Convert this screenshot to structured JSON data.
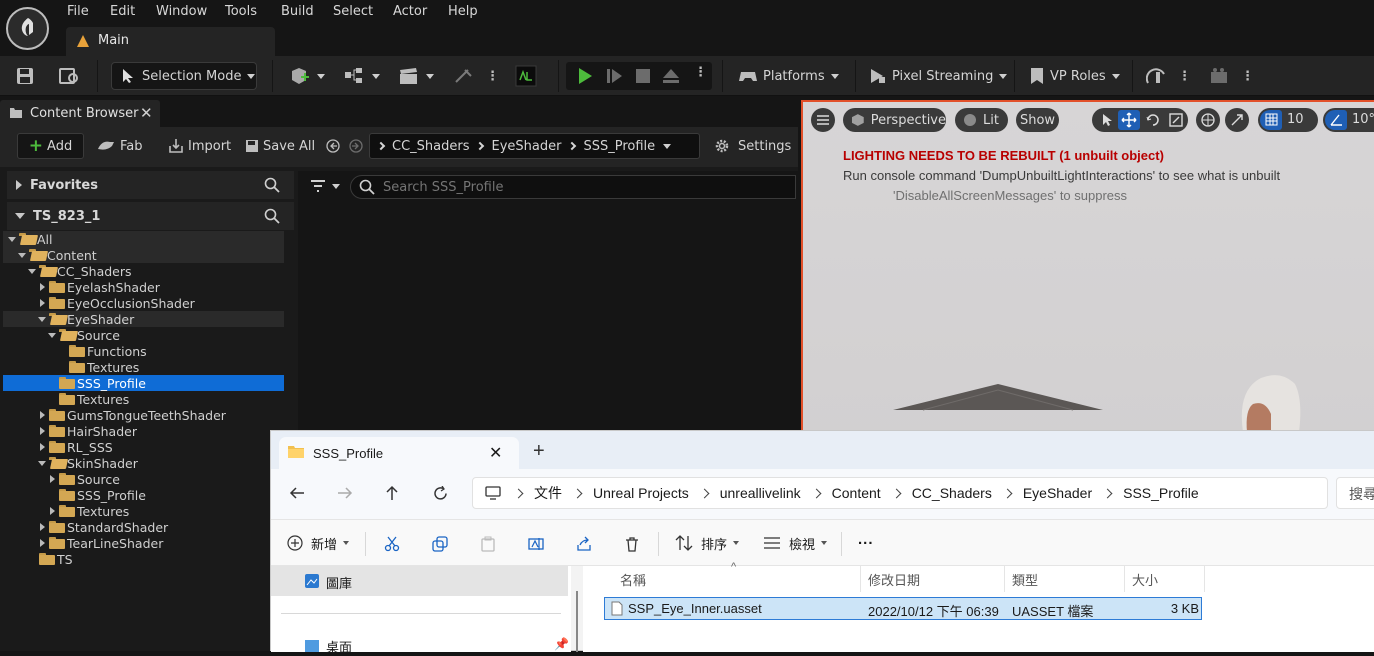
{
  "menu": {
    "items": [
      "File",
      "Edit",
      "Window",
      "Tools",
      "Build",
      "Select",
      "Actor",
      "Help"
    ],
    "tab_label": "Main"
  },
  "toolbar": {
    "selection_mode": "Selection Mode",
    "platforms": "Platforms",
    "pixel_streaming": "Pixel Streaming",
    "vp_roles": "VP Roles"
  },
  "content_browser": {
    "tab_title": "Content Browser",
    "add": "Add",
    "fab": "Fab",
    "import": "Import",
    "save_all": "Save All",
    "settings": "Settings",
    "breadcrumbs": [
      "CC_Shaders",
      "EyeShader",
      "SSS_Profile"
    ],
    "favorites": "Favorites",
    "project": "TS_823_1",
    "search_placeholder": "Search SSS_Profile",
    "tree": [
      {
        "label": "All",
        "indent": 0,
        "expand": "down",
        "open": true
      },
      {
        "label": "Content",
        "indent": 1,
        "expand": "down",
        "open": true
      },
      {
        "label": "CC_Shaders",
        "indent": 2,
        "expand": "down",
        "open": true
      },
      {
        "label": "EyelashShader",
        "indent": 3,
        "expand": "right",
        "open": false
      },
      {
        "label": "EyeOcclusionShader",
        "indent": 3,
        "expand": "right",
        "open": false
      },
      {
        "label": "EyeShader",
        "indent": 3,
        "expand": "down",
        "open": true
      },
      {
        "label": "Source",
        "indent": 4,
        "expand": "down",
        "open": true
      },
      {
        "label": "Functions",
        "indent": 5,
        "expand": "none",
        "open": false
      },
      {
        "label": "Textures",
        "indent": 5,
        "expand": "none",
        "open": false
      },
      {
        "label": "SSS_Profile",
        "indent": 4,
        "expand": "none",
        "open": false
      },
      {
        "label": "Textures",
        "indent": 4,
        "expand": "none",
        "open": false
      },
      {
        "label": "GumsTongueTeethShader",
        "indent": 3,
        "expand": "right",
        "open": false
      },
      {
        "label": "HairShader",
        "indent": 3,
        "expand": "right",
        "open": false
      },
      {
        "label": "RL_SSS",
        "indent": 3,
        "expand": "right",
        "open": false
      },
      {
        "label": "SkinShader",
        "indent": 3,
        "expand": "down",
        "open": true
      },
      {
        "label": "Source",
        "indent": 4,
        "expand": "right",
        "open": false
      },
      {
        "label": "SSS_Profile",
        "indent": 4,
        "expand": "none",
        "open": false
      },
      {
        "label": "Textures",
        "indent": 4,
        "expand": "right",
        "open": false
      },
      {
        "label": "StandardShader",
        "indent": 3,
        "expand": "right",
        "open": false
      },
      {
        "label": "TearLineShader",
        "indent": 3,
        "expand": "right",
        "open": false
      },
      {
        "label": "TS",
        "indent": 2,
        "expand": "none",
        "open": false
      }
    ],
    "selected_index": 9,
    "highlight_indices": [
      0,
      1,
      5
    ]
  },
  "viewport": {
    "perspective": "Perspective",
    "lit": "Lit",
    "show": "Show",
    "grid_value": "10",
    "angle_value": "10°",
    "warning_title": "LIGHTING NEEDS TO BE REBUILT (1 unbuilt object)",
    "warning_line": "Run console command 'DumpUnbuiltLightInteractions' to see what is unbuilt",
    "warning_suppress": "'DisableAllScreenMessages' to suppress"
  },
  "explorer": {
    "tab_title": "SSS_Profile",
    "path": [
      "文件",
      "Unreal Projects",
      "unreallivelink",
      "Content",
      "CC_Shaders",
      "EyeShader",
      "SSS_Profile"
    ],
    "search_placeholder": "搜尋",
    "new": "新增",
    "sort": "排序",
    "view": "檢視",
    "more": "...",
    "nav": [
      "圖庫",
      "桌面"
    ],
    "columns": {
      "name": "名稱",
      "modified": "修改日期",
      "type": "類型",
      "size": "大小"
    },
    "files": [
      {
        "name": "SSP_Eye_Inner.uasset",
        "modified": "2022/10/12 下午 06:39",
        "type": "UASSET 檔案",
        "size": "3 KB"
      }
    ]
  },
  "colors": {
    "selection_blue": "#0f6cd6",
    "play_green": "#4dbb3c",
    "warning_red": "#b80000",
    "viewport_border": "#e2502a"
  }
}
